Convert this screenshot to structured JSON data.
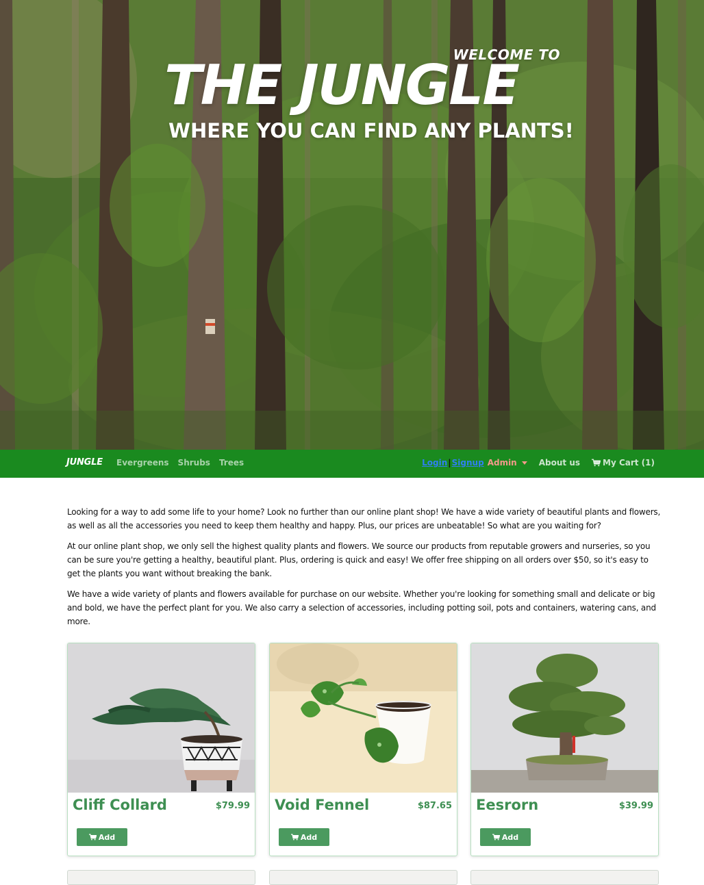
{
  "hero": {
    "welcome": "WELCOME TO",
    "title": "THE JUNGLE",
    "tagline": "WHERE YOU CAN FIND ANY PLANTS!"
  },
  "navbar": {
    "brand": "JUNGLE",
    "links": [
      "Evergreens",
      "Shrubs",
      "Trees"
    ],
    "login": "Login",
    "signup": "Signup",
    "admin": "Admin",
    "about": "About us",
    "cart": "My Cart (1)",
    "colors": {
      "background": "#1a8a1f",
      "auth": "#2f7ff0",
      "admin": "#f39a8a"
    }
  },
  "description": [
    "Looking for a way to add some life to your home? Look no further than our online plant shop! We have a wide variety of beautiful plants and flowers, as well as all the accessories you need to keep them healthy and happy. Plus, our prices are unbeatable! So what are you waiting for?",
    "At our online plant shop, we only sell the highest quality plants and flowers. We source our products from reputable growers and nurseries, so you can be sure you're getting a healthy, beautiful plant. Plus, ordering is quick and easy! We offer free shipping on all orders over $50, so it's easy to get the plants you want without breaking the bank.",
    "We have a wide variety of plants and flowers available for purchase on our website. Whether you're looking for something small and delicate or big and bold, we have the perfect plant for you. We also carry a selection of accessories, including potting soil, pots and containers, watering cans, and more."
  ],
  "products": [
    {
      "name": "Cliff Collard",
      "price": "$79.99",
      "button": "Add",
      "image": "juniper-bonsai-patterned-pot"
    },
    {
      "name": "Void Fennel",
      "price": "$87.65",
      "button": "Add",
      "image": "pothos-white-pot"
    },
    {
      "name": "Eesrorn",
      "price": "$39.99",
      "button": "Add",
      "image": "bonsai-tree-tray"
    }
  ],
  "accent_color": "#3e8f52",
  "icons": {
    "cart": "shopping-cart-icon",
    "caret": "chevron-down-icon"
  }
}
